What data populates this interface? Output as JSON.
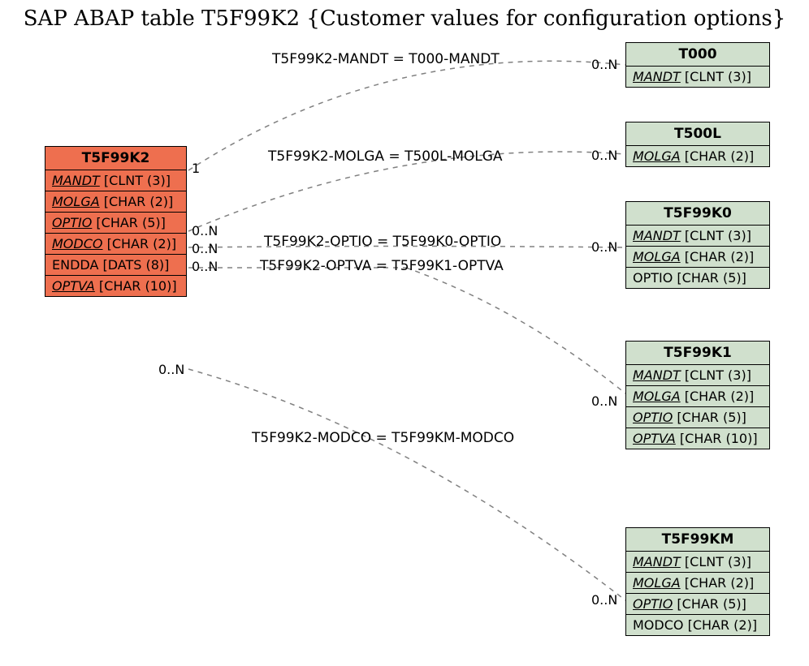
{
  "title": "SAP ABAP table T5F99K2 {Customer values for configuration options}",
  "main_entity": {
    "name": "T5F99K2",
    "fields": [
      {
        "key": true,
        "text": "MANDT [CLNT (3)]"
      },
      {
        "key": true,
        "text": "MOLGA [CHAR (2)]"
      },
      {
        "key": true,
        "text": "OPTIO [CHAR (5)]"
      },
      {
        "key": true,
        "text": "MODCO [CHAR (2)]"
      },
      {
        "key": false,
        "text": "ENDDA [DATS (8)]"
      },
      {
        "key": true,
        "text": "OPTVA [CHAR (10)]"
      }
    ]
  },
  "related": [
    {
      "name": "T000",
      "fields": [
        {
          "key": true,
          "text": "MANDT [CLNT (3)]"
        }
      ]
    },
    {
      "name": "T500L",
      "fields": [
        {
          "key": true,
          "text": "MOLGA [CHAR (2)]"
        }
      ]
    },
    {
      "name": "T5F99K0",
      "fields": [
        {
          "key": true,
          "text": "MANDT [CLNT (3)]"
        },
        {
          "key": true,
          "text": "MOLGA [CHAR (2)]"
        },
        {
          "key": false,
          "text": "OPTIO [CHAR (5)]"
        }
      ]
    },
    {
      "name": "T5F99K1",
      "fields": [
        {
          "key": true,
          "text": "MANDT [CLNT (3)]"
        },
        {
          "key": true,
          "text": "MOLGA [CHAR (2)]"
        },
        {
          "key": true,
          "text": "OPTIO [CHAR (5)]"
        },
        {
          "key": true,
          "text": "OPTVA [CHAR (10)]"
        }
      ]
    },
    {
      "name": "T5F99KM",
      "fields": [
        {
          "key": true,
          "text": "MANDT [CLNT (3)]"
        },
        {
          "key": true,
          "text": "MOLGA [CHAR (2)]"
        },
        {
          "key": true,
          "text": "OPTIO [CHAR (5)]"
        },
        {
          "key": false,
          "text": "MODCO [CHAR (2)]"
        }
      ]
    }
  ],
  "relations": [
    {
      "label": "T5F99K2-MANDT = T000-MANDT",
      "left_card": "1",
      "right_card": "0..N"
    },
    {
      "label": "T5F99K2-MOLGA = T500L-MOLGA",
      "left_card": "0..N",
      "right_card": "0..N"
    },
    {
      "label": "T5F99K2-OPTIO = T5F99K0-OPTIO",
      "left_card": "0..N",
      "right_card": "0..N"
    },
    {
      "label": "T5F99K2-OPTVA = T5F99K1-OPTVA",
      "left_card": "0..N",
      "right_card": ""
    },
    {
      "label": "T5F99K2-MODCO = T5F99KM-MODCO",
      "left_card": "0..N",
      "right_card": "0..N"
    }
  ],
  "extra_card": "0..N"
}
